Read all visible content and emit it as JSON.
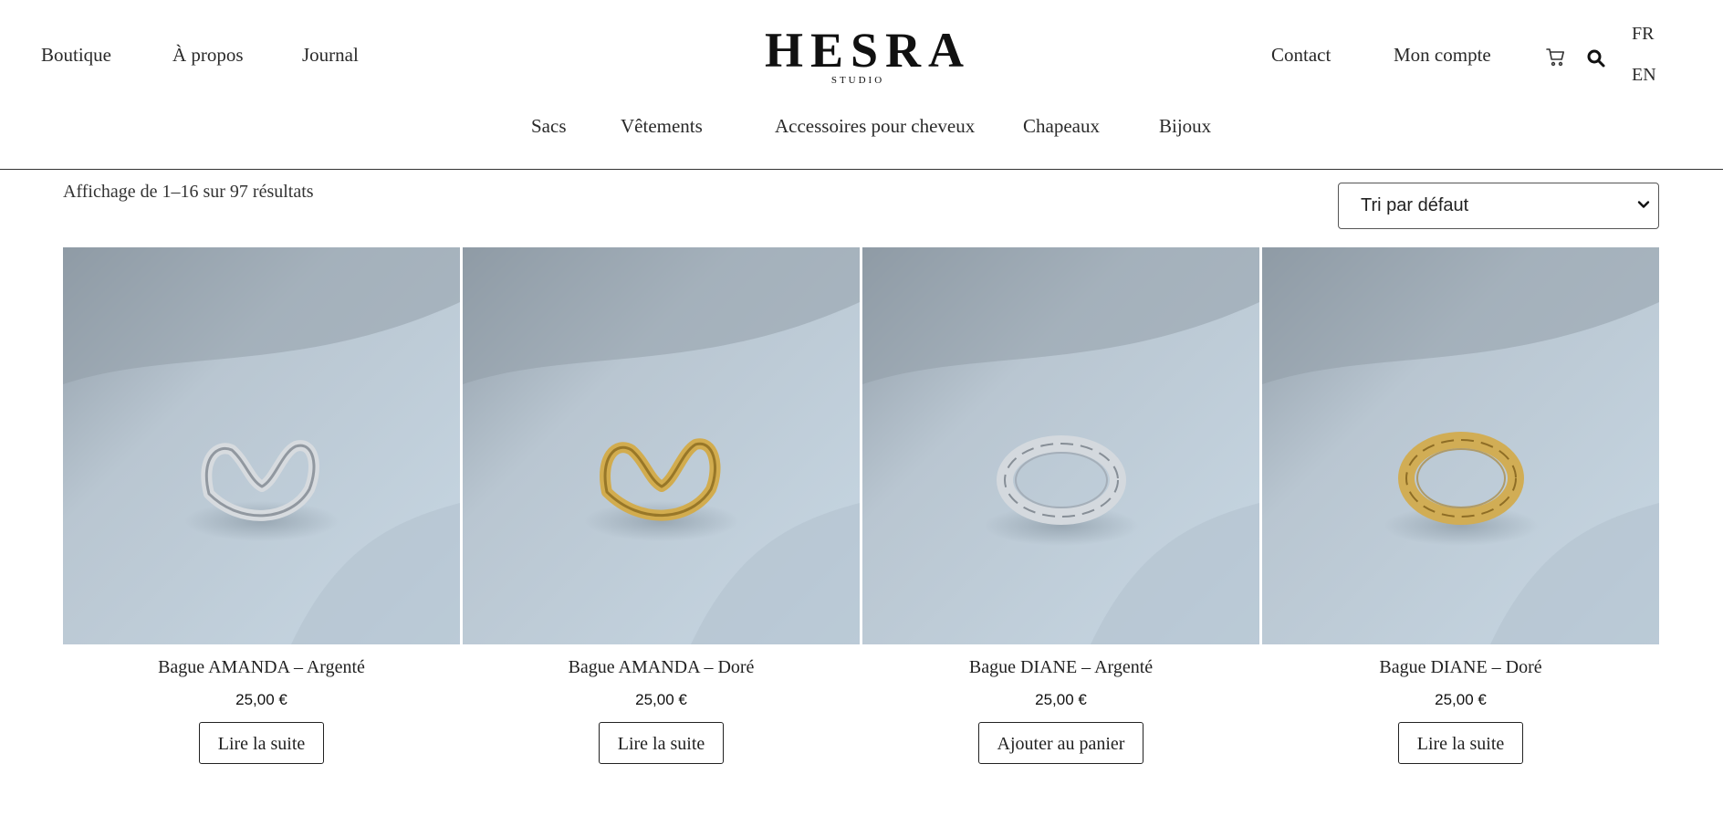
{
  "header": {
    "left_nav": [
      "Boutique",
      "À propos",
      "Journal"
    ],
    "logo": {
      "main": "HESRA",
      "sub": "STUDIO"
    },
    "right_nav": [
      "Contact",
      "Mon compte"
    ],
    "languages": [
      "FR",
      "EN"
    ],
    "icons": [
      "cart-icon",
      "search-icon"
    ]
  },
  "categories": [
    "Sacs",
    "Vêtements",
    "Accessoires pour cheveux",
    "Chapeaux",
    "Bijoux"
  ],
  "toolbar": {
    "result_count": "Affichage de 1–16 sur 97 résultats",
    "sort_selected": "Tri par défaut"
  },
  "products": [
    {
      "title": "Bague AMANDA – Argenté",
      "price": "25,00 €",
      "button": "Lire la suite",
      "metal": "silver",
      "style": "wave"
    },
    {
      "title": "Bague AMANDA – Doré",
      "price": "25,00 €",
      "button": "Lire la suite",
      "metal": "gold",
      "style": "wave"
    },
    {
      "title": "Bague DIANE – Argenté",
      "price": "25,00 €",
      "button": "Ajouter au panier",
      "metal": "silver",
      "style": "chain"
    },
    {
      "title": "Bague DIANE – Doré",
      "price": "25,00 €",
      "button": "Lire la suite",
      "metal": "gold",
      "style": "chain"
    }
  ],
  "colors": {
    "silver": "#c9ced3",
    "gold": "#c9a54a",
    "background_fabric": "#c3d2de"
  }
}
